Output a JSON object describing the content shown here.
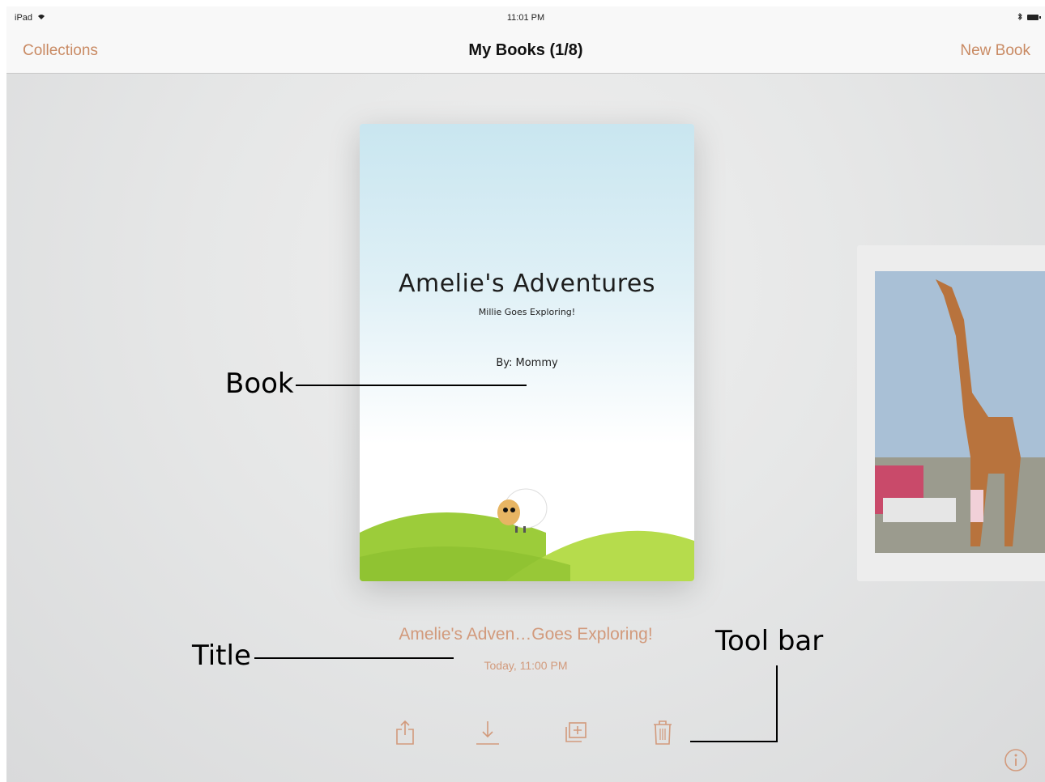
{
  "status_bar": {
    "device": "iPad",
    "time": "11:01 PM"
  },
  "nav_bar": {
    "left_button": "Collections",
    "title": "My Books (1/8)",
    "right_button": "New Book"
  },
  "book": {
    "cover_title": "Amelie's Adventures",
    "cover_subtitle": "Millie Goes Exploring!",
    "cover_author": "By: Mommy",
    "display_title": "Amelie's Adven…Goes Exploring!",
    "modified": "Today, 11:00 PM"
  },
  "toolbar": {
    "items": [
      {
        "icon": "share-icon"
      },
      {
        "icon": "download-icon"
      },
      {
        "icon": "duplicate-icon"
      },
      {
        "icon": "trash-icon"
      }
    ]
  },
  "info_icon": "info-icon",
  "callouts": {
    "book": "Book",
    "title": "Title",
    "toolbar": "Tool bar"
  },
  "colors": {
    "accent": "#c98a63",
    "title_text": "#d29a7c"
  }
}
